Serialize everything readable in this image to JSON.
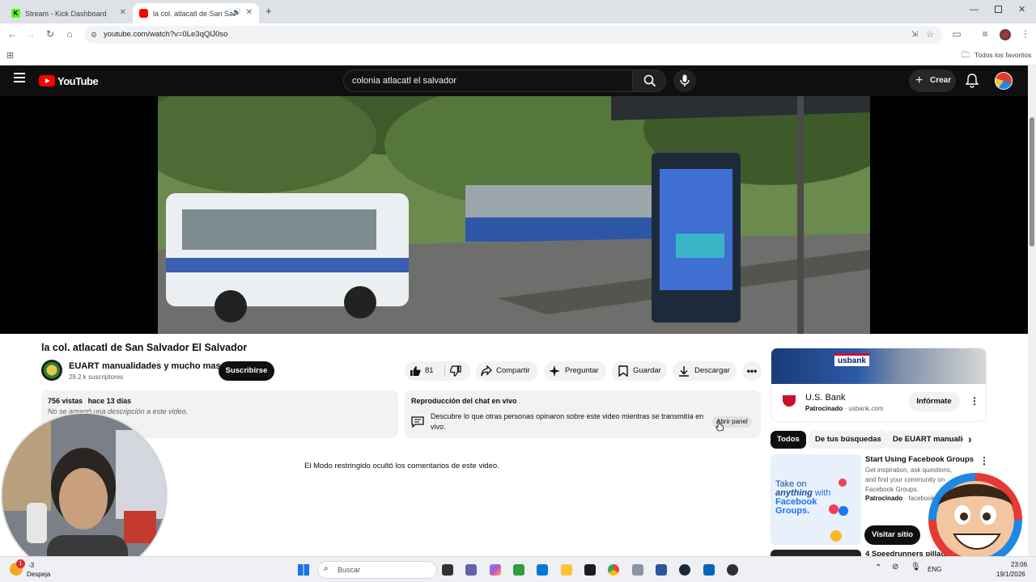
{
  "browser": {
    "tabs": [
      {
        "label": "Stream - Kick Dashboard"
      },
      {
        "label": "la col. atlacatl de San Salva"
      }
    ],
    "url": "youtube.com/watch?v=0Le3qQlJ0so",
    "bookmarks_label": "Todos los favoritos"
  },
  "youtube": {
    "logo_text": "YouTube",
    "search_value": "colonia atlacatl el salvador",
    "create_label": "Crear"
  },
  "video": {
    "title": "la col. atlacatl de San Salvador El Salvador",
    "channel_name": "EUART manualidades y mucho mas",
    "subscribers": "28.2 k suscriptores",
    "subscribe_label": "Suscribirse",
    "likes": "81",
    "share_label": "Compartir",
    "ask_label": "Preguntar",
    "save_label": "Guardar",
    "download_label": "Descargar"
  },
  "description": {
    "views": "756 vistas",
    "age": "hace 13 días",
    "text": "No se agregó una descripción a este video."
  },
  "chat_replay": {
    "title": "Reproducción del chat en vivo",
    "text": "Descubre lo que otras personas opinaron sobre este video mientras se transmitía en vivo.",
    "button": "Abrir panel"
  },
  "comments_notice": "El Modo restringido ocultó los comentarios de este video.",
  "ad": {
    "brand": "U.S. Bank",
    "sponsored": "Patrocinado",
    "domain": "usbank.com",
    "banner_text": "usbank",
    "cta": "Infórmate"
  },
  "chips": [
    "Todos",
    "De tus búsquedas",
    "De EUART manualic"
  ],
  "sidebar_items": [
    {
      "title": "Start Using Facebook Groups",
      "desc": "Get inspiration, ask questions, and find your community on Facebook Groups.",
      "sponsored": "Patrocinado",
      "domain": "facebook",
      "thumb_line1": "Take on",
      "thumb_line2": "anything",
      "thumb_line3": "with",
      "thumb_line4": "Facebook",
      "thumb_line5": "Groups.",
      "cta": "Visitar sitio"
    },
    {
      "title": "4 Speedrunners pillad"
    }
  ],
  "taskbar": {
    "search_placeholder": "Buscar",
    "weather_temp": "-3",
    "weather_desc": "Despeja",
    "lang": "ENG",
    "time": "23:06",
    "date": "19/1/2026",
    "notification_count": "1"
  },
  "colors": {
    "yt_red": "#ff0000",
    "kick_green": "#53fc18",
    "facebook_blue": "#1877f2",
    "usbank_red": "#c8102e"
  }
}
